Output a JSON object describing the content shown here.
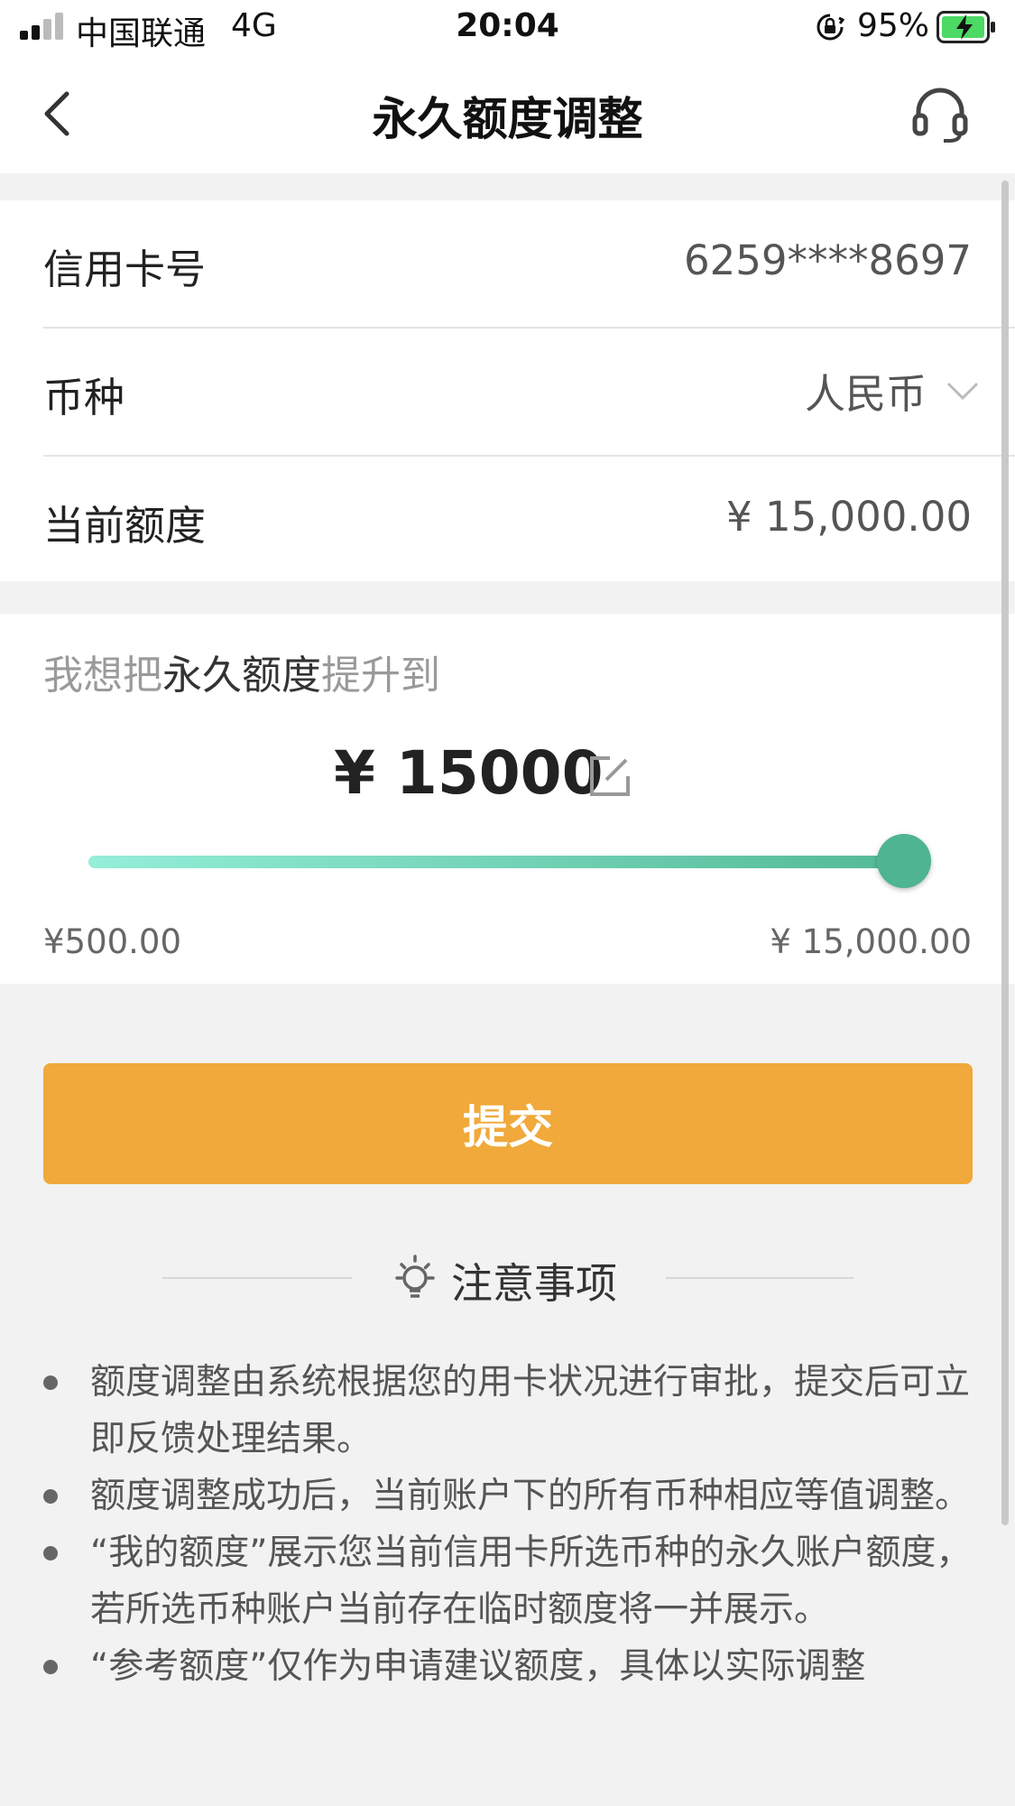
{
  "status_bar": {
    "carrier": "中国联通",
    "network": "4G",
    "time": "20:04",
    "battery_percent": "95%"
  },
  "nav": {
    "title": "永久额度调整",
    "back_icon": "chevron-left-icon",
    "service_icon": "headset-icon"
  },
  "card_info": {
    "card_number_label": "信用卡号",
    "card_number_value": "6259****8697",
    "currency_label": "币种",
    "currency_value": "人民币",
    "current_limit_label": "当前额度",
    "current_limit_value": "¥ 15,000.00"
  },
  "adjust": {
    "prompt_prefix": "我想把",
    "prompt_highlight": "永久额度",
    "prompt_suffix": "提升到",
    "amount": "¥ 15000",
    "slider_min_label": "¥500.00",
    "slider_max_label": "¥ 15,000.00",
    "slider_position": 1.0
  },
  "submit_label": "提交",
  "notes": {
    "title": "注意事项",
    "items": [
      "额度调整由系统根据您的用卡状况进行审批，提交后可立即反馈处理结果。",
      "额度调整成功后，当前账户下的所有币种相应等值调整。",
      "“我的额度”展示您当前信用卡所选币种的永久账户额度，若所选币种账户当前存在临时额度将一并展示。",
      "“参考额度”仅作为申请建议额度，具体以实际调整"
    ]
  },
  "colors": {
    "accent_orange": "#f0a93a",
    "slider_start": "#94eed8",
    "slider_end": "#52b894",
    "battery_green": "#4cd964"
  }
}
